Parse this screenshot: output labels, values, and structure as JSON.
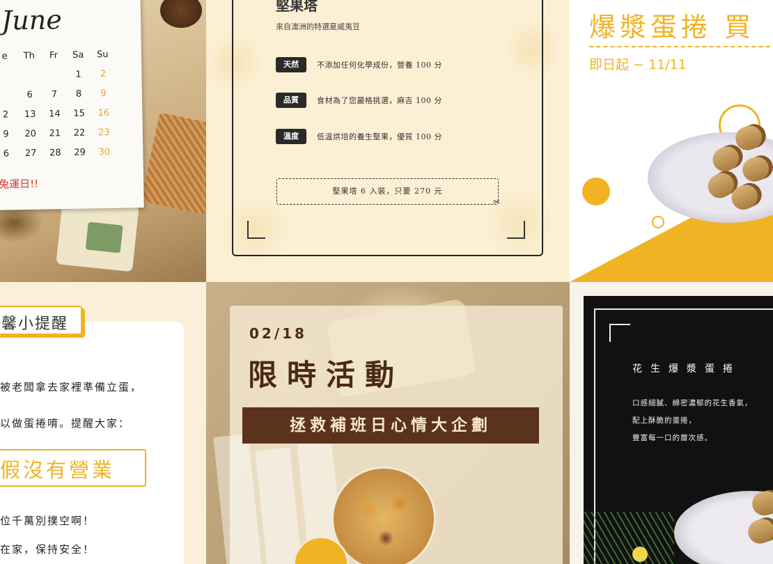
{
  "tile1": {
    "month": "June",
    "weekday_headers": [
      "e",
      "Th",
      "Fr",
      "Sa",
      "Su"
    ],
    "weeks": [
      [
        "",
        "",
        "",
        "1",
        "2"
      ],
      [
        "",
        "6",
        "7",
        "8",
        "9"
      ],
      [
        "2",
        "13",
        "14",
        "15",
        "16"
      ],
      [
        "9",
        "20",
        "21",
        "22",
        "23"
      ],
      [
        "6",
        "27",
        "28",
        "29",
        "30"
      ]
    ],
    "note": "兔運日!!"
  },
  "tile2": {
    "title": "堅果塔",
    "subtitle": "來自澳洲的特選夏威夷豆",
    "features": [
      {
        "tag": "天然",
        "text": "不添加任何化學成份，營養 100 分"
      },
      {
        "tag": "品質",
        "text": "食材為了您嚴格挑選，麻吉 100 分"
      },
      {
        "tag": "溫度",
        "text": "低溫烘培的養生堅果，優質 100 分"
      }
    ],
    "coupon": "堅果塔 6 入裝，只要 270 元",
    "scissor": "✂"
  },
  "tile3": {
    "title": "爆漿蛋捲 買",
    "date": "即日起 ~ 11/11"
  },
  "tile4": {
    "label": "馨小提醒",
    "lines": [
      "被老闆拿去家裡準備立蛋，",
      "以做蛋捲唷。提醒大家："
    ],
    "highlight": "假沒有營業",
    "lines_after": [
      "位千萬別撲空啊！",
      "在家，保持安全！"
    ]
  },
  "tile5": {
    "date": "02/18",
    "headline": "限時活動",
    "banner": "拯救補班日心情大企劃"
  },
  "tile6": {
    "title": "花生爆漿蛋捲",
    "lines": [
      "口感細膩、綿密濃郁的花生香氣，",
      "配上酥脆的蛋捲，",
      "豐富每一口的層次感。"
    ]
  },
  "colors": {
    "accent_yellow": "#f0b323",
    "dark_brown": "#5b321c",
    "calendar_sunday": "#e6a72e",
    "note_red": "#d9342b"
  }
}
